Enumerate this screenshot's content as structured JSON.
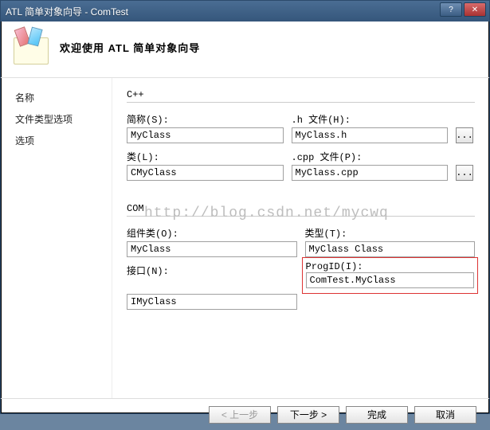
{
  "window": {
    "title": "ATL 简单对象向导 - ComTest"
  },
  "header": {
    "heading": "欢迎使用 ATL 简单对象向导"
  },
  "sidebar": {
    "items": [
      {
        "label": "名称"
      },
      {
        "label": "文件类型选项"
      },
      {
        "label": "选项"
      }
    ]
  },
  "cpp": {
    "section": "C++",
    "short_label": "简称(S):",
    "short_value": "MyClass",
    "h_label": ".h 文件(H):",
    "h_value": "MyClass.h",
    "class_label": "类(L):",
    "class_value": "CMyClass",
    "cpp_label": ".cpp 文件(P):",
    "cpp_value": "MyClass.cpp",
    "browse": "..."
  },
  "com": {
    "section": "COM",
    "coclass_label": "组件类(O):",
    "coclass_value": "MyClass",
    "type_label": "类型(T):",
    "type_value": "MyClass Class",
    "interface_label": "接口(N):",
    "interface_value": "IMyClass",
    "progid_label": "ProgID(I):",
    "progid_value": "ComTest.MyClass"
  },
  "footer": {
    "prev": "< 上一步",
    "next": "下一步 >",
    "finish": "完成",
    "cancel": "取消"
  },
  "watermark": "http://blog.csdn.net/mycwq"
}
